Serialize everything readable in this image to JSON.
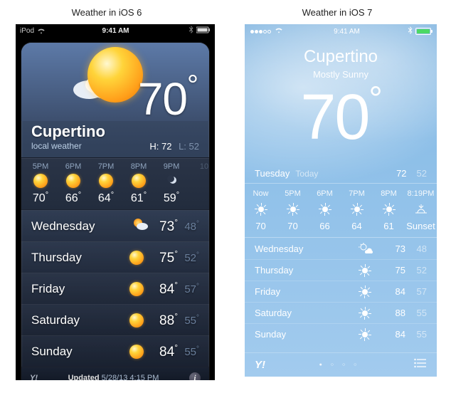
{
  "captions": {
    "left": "Weather in iOS 6",
    "right": "Weather in iOS 7"
  },
  "ios6": {
    "status": {
      "carrier": "iPod",
      "time": "9:41 AM"
    },
    "city": "Cupertino",
    "subtitle": "local weather",
    "temp": "70",
    "high_label": "H:",
    "high": "72",
    "low_label": "L:",
    "low": "52",
    "hourly": [
      {
        "time": "5PM",
        "icon": "sun",
        "temp": "70"
      },
      {
        "time": "6PM",
        "icon": "sun",
        "temp": "66"
      },
      {
        "time": "7PM",
        "icon": "sun",
        "temp": "64"
      },
      {
        "time": "8PM",
        "icon": "sun",
        "temp": "61"
      },
      {
        "time": "9PM",
        "icon": "night",
        "temp": "59"
      },
      {
        "time": "10",
        "icon": "",
        "temp": ""
      }
    ],
    "daily": [
      {
        "day": "Wednesday",
        "icon": "partly",
        "hi": "73",
        "lo": "48"
      },
      {
        "day": "Thursday",
        "icon": "sun",
        "hi": "75",
        "lo": "52"
      },
      {
        "day": "Friday",
        "icon": "sun",
        "hi": "84",
        "lo": "57"
      },
      {
        "day": "Saturday",
        "icon": "sun",
        "hi": "88",
        "lo": "55"
      },
      {
        "day": "Sunday",
        "icon": "sun",
        "hi": "84",
        "lo": "55"
      }
    ],
    "footer": {
      "yahoo": "Y!",
      "updated_label": "Updated",
      "updated_value": "5/28/13 4:15 PM"
    }
  },
  "ios7": {
    "status": {
      "time": "9:41 AM"
    },
    "city": "Cupertino",
    "condition": "Mostly Sunny",
    "temp": "70",
    "dayline": {
      "day": "Tuesday",
      "today": "Today",
      "hi": "72",
      "lo": "52"
    },
    "hourly": [
      {
        "time": "Now",
        "icon": "sun",
        "temp": "70"
      },
      {
        "time": "5PM",
        "icon": "sun",
        "temp": "70"
      },
      {
        "time": "6PM",
        "icon": "sun",
        "temp": "66"
      },
      {
        "time": "7PM",
        "icon": "sun",
        "temp": "64"
      },
      {
        "time": "8PM",
        "icon": "sun",
        "temp": "61"
      },
      {
        "time": "8:19PM",
        "icon": "sunset",
        "temp": "Sunset"
      }
    ],
    "daily": [
      {
        "day": "Wednesday",
        "icon": "cloud",
        "hi": "73",
        "lo": "48"
      },
      {
        "day": "Thursday",
        "icon": "sun",
        "hi": "75",
        "lo": "52"
      },
      {
        "day": "Friday",
        "icon": "sun",
        "hi": "84",
        "lo": "57"
      },
      {
        "day": "Saturday",
        "icon": "sun",
        "hi": "88",
        "lo": "55"
      },
      {
        "day": "Sunday",
        "icon": "sun",
        "hi": "84",
        "lo": "55"
      }
    ],
    "footer": {
      "yahoo": "Y!"
    }
  }
}
